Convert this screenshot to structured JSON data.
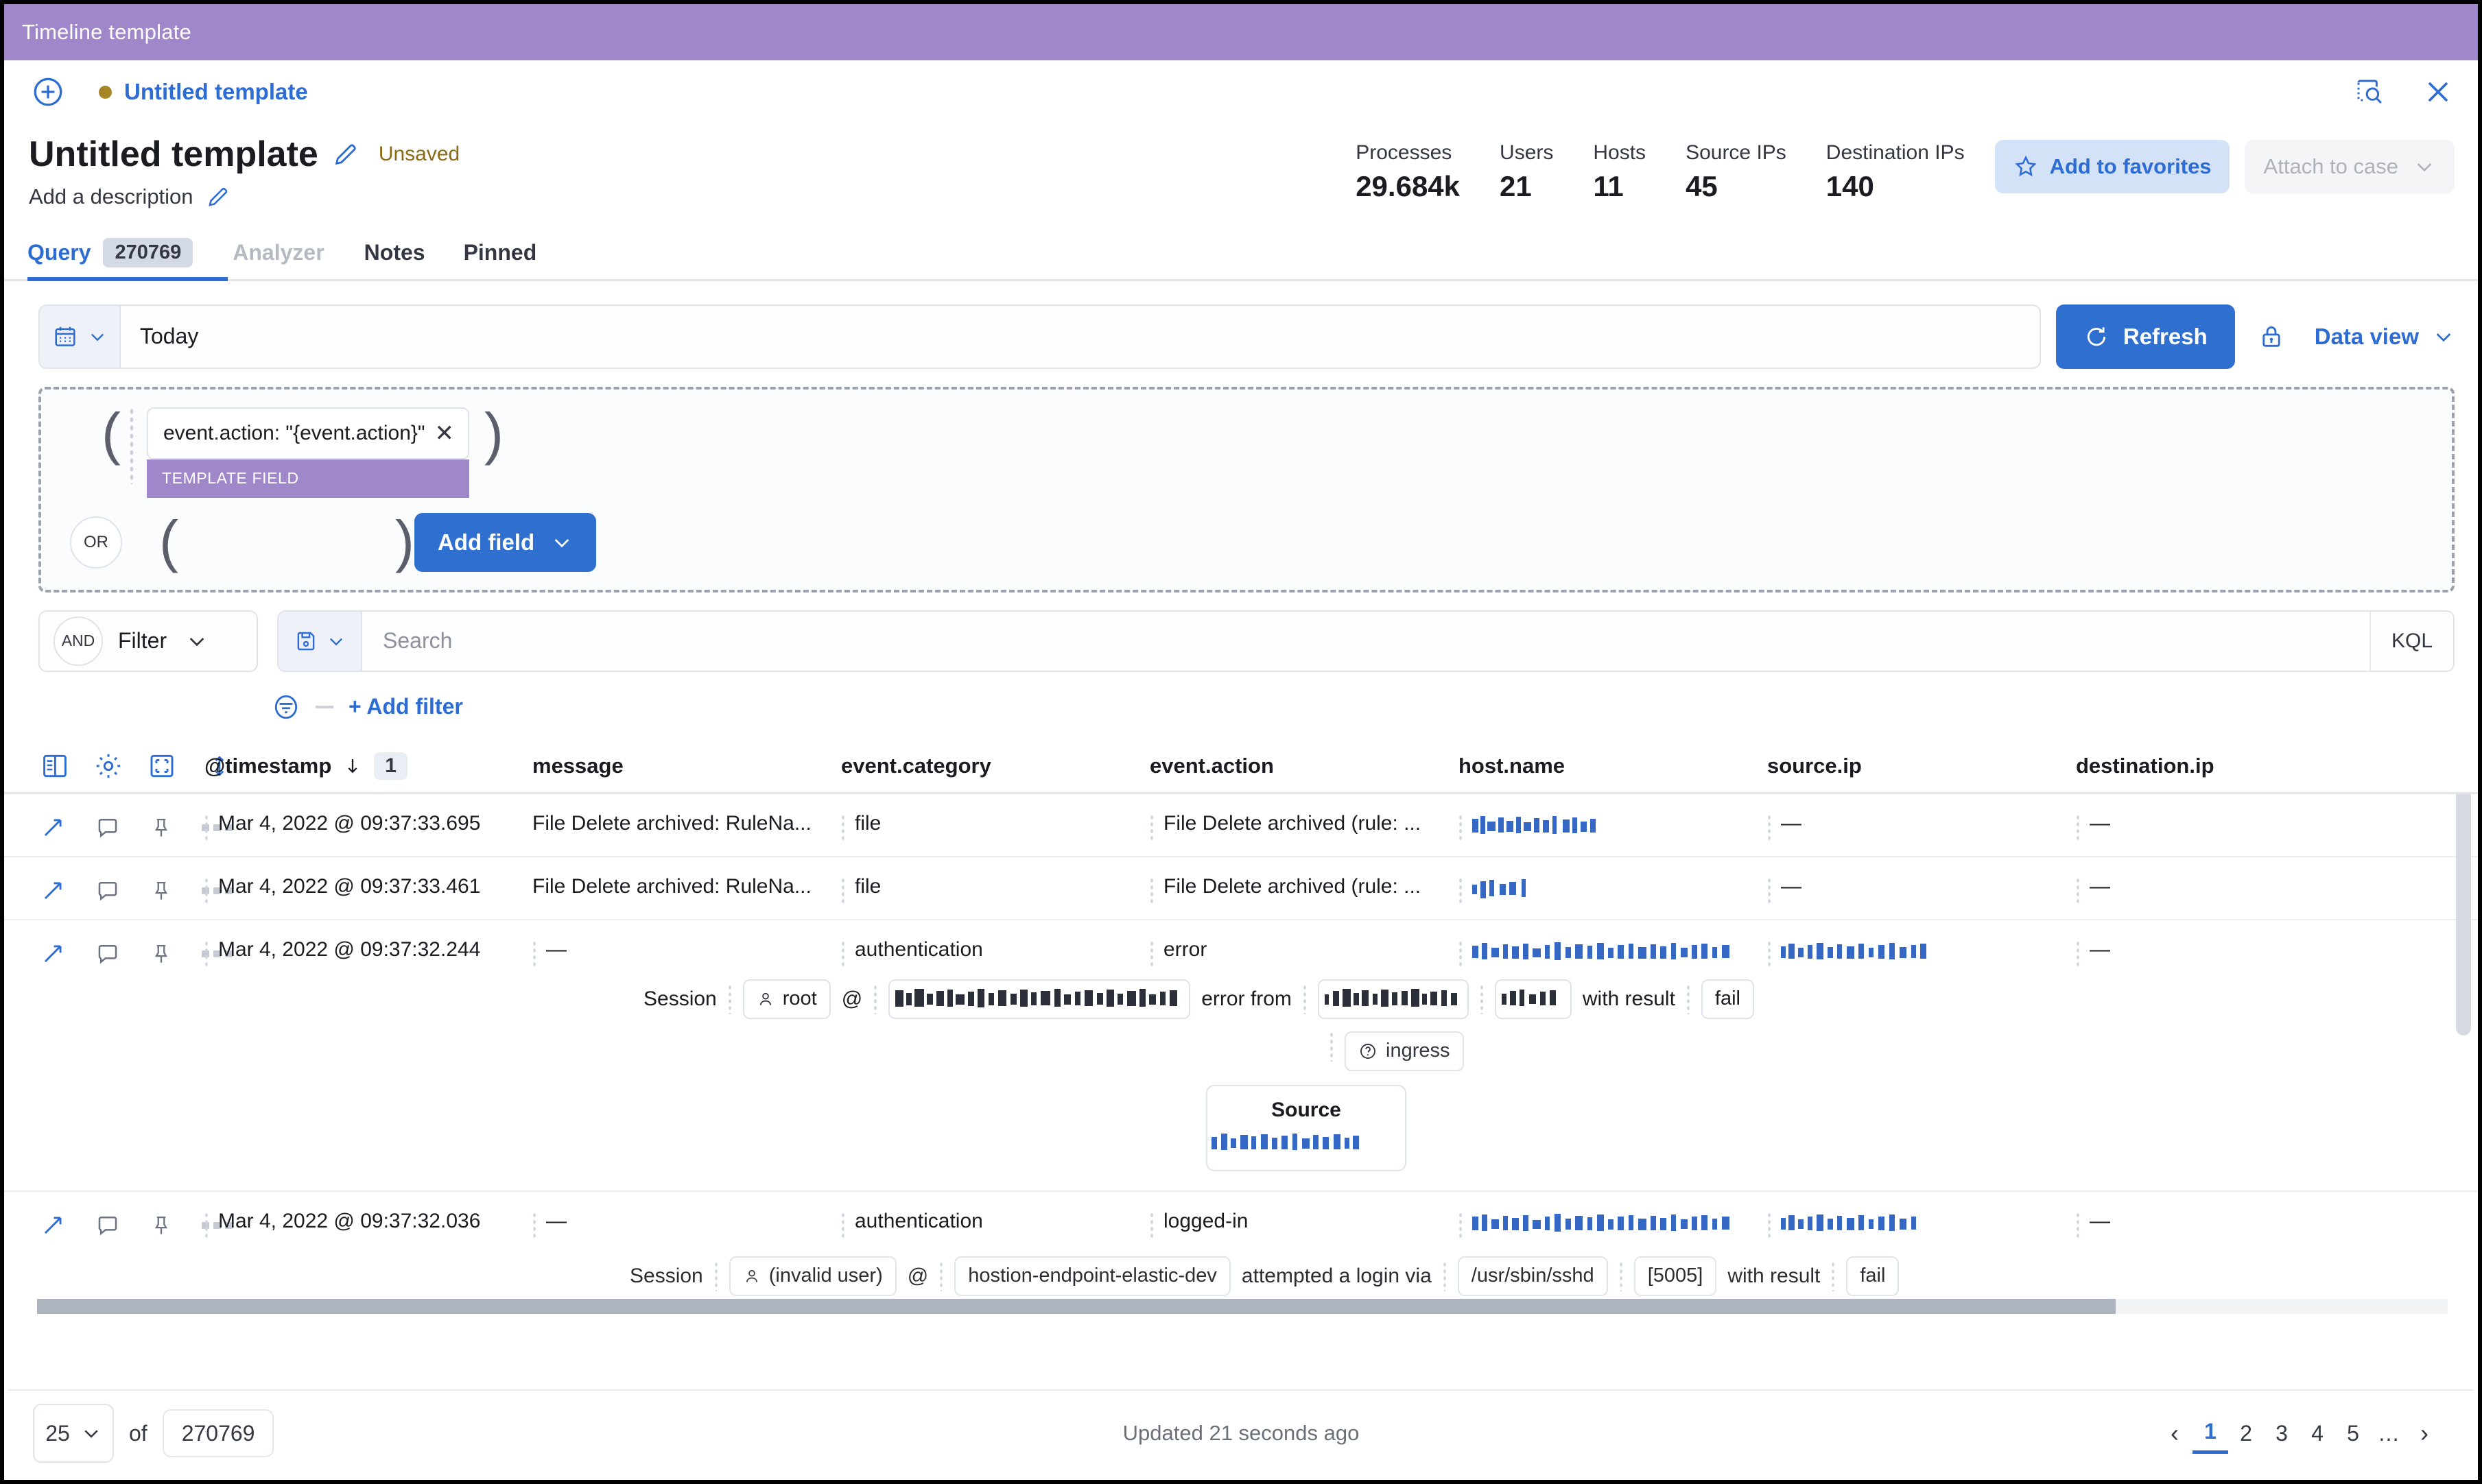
{
  "window": {
    "title": "Timeline template"
  },
  "tabstrip": {
    "add_label": "add-timeline",
    "tab_label": "Untitled template",
    "inspect_label": "inspect",
    "close_label": "close"
  },
  "header": {
    "title": "Untitled template",
    "status": "Unsaved",
    "description_placeholder": "Add a description",
    "stats": [
      {
        "label": "Processes",
        "value": "29.684k"
      },
      {
        "label": "Users",
        "value": "21"
      },
      {
        "label": "Hosts",
        "value": "11"
      },
      {
        "label": "Source IPs",
        "value": "45"
      },
      {
        "label": "Destination IPs",
        "value": "140"
      }
    ],
    "favorites_label": "Add to favorites",
    "attach_case_label": "Attach to case"
  },
  "nav_tabs": [
    {
      "label": "Query",
      "count": "270769",
      "active": true
    },
    {
      "label": "Analyzer",
      "count": "",
      "active": false,
      "disabled": true
    },
    {
      "label": "Notes",
      "count": "",
      "active": false
    },
    {
      "label": "Pinned",
      "count": "",
      "active": false
    }
  ],
  "query_bar": {
    "date_value": "Today",
    "refresh_label": "Refresh",
    "data_view_label": "Data view"
  },
  "builder": {
    "field_chip": "event.action: \"{event.action}\"",
    "template_badge": "TEMPLATE FIELD",
    "or_label": "OR",
    "add_field_label": "Add field",
    "open_paren": "(",
    "close_paren": ")"
  },
  "filter_bar": {
    "and_label": "AND",
    "filter_label": "Filter",
    "search_placeholder": "Search",
    "kql_label": "KQL",
    "add_filter_label": "+ Add filter"
  },
  "table": {
    "columns": [
      "@timestamp",
      "message",
      "event.category",
      "event.action",
      "host.name",
      "source.ip",
      "destination.ip"
    ],
    "sort_column": "@timestamp",
    "sort_direction": "desc",
    "sort_badge": "1",
    "rows": [
      {
        "timestamp": "Mar 4, 2022 @ 09:37:33.695",
        "message": "File Delete archived: RuleNa...",
        "event_category": "file",
        "event_action": "File Delete archived (rule: ...",
        "host_name": "",
        "host_redacted": true,
        "source_ip": "—",
        "destination_ip": "—",
        "expanded": false
      },
      {
        "timestamp": "Mar 4, 2022 @ 09:37:33.461",
        "message": "File Delete archived: RuleNa...",
        "event_category": "file",
        "event_action": "File Delete archived (rule: ...",
        "host_name": "",
        "host_redacted": true,
        "source_ip": "—",
        "destination_ip": "—",
        "expanded": false
      },
      {
        "timestamp": "Mar 4, 2022 @ 09:37:32.244",
        "message": "—",
        "event_category": "authentication",
        "event_action": "error",
        "host_name": "",
        "host_redacted": true,
        "source_ip": "",
        "source_redacted": true,
        "destination_ip": "—",
        "expanded": true,
        "detail": {
          "session_label": "Session",
          "user_chip": "root",
          "at_symbol": "@",
          "host_chip_redacted": true,
          "error_label": "error from",
          "from_chip_redacted": true,
          "port_chip_redacted": true,
          "with_result_label": "with result",
          "result_chip": "fail",
          "ingress_chip": "ingress",
          "source_box_title": "Source",
          "source_box_redacted": true
        }
      },
      {
        "timestamp": "Mar 4, 2022 @ 09:37:32.036",
        "message": "—",
        "event_category": "authentication",
        "event_action": "logged-in",
        "host_name": "",
        "host_redacted": true,
        "source_ip": "",
        "source_redacted": true,
        "destination_ip": "—",
        "expanded": false
      }
    ],
    "clipped_row": {
      "session_label": "Session",
      "user_chip": "(invalid user)",
      "at_symbol": "@",
      "host_chip": "hostion-endpoint-elastic-dev",
      "attempt_label": "attempted a login via",
      "path_chip": "/usr/sbin/sshd",
      "port_chip": "[5005]",
      "with_result_label": "with result",
      "result_chip": "fail"
    }
  },
  "footer": {
    "per_page": "25",
    "of_label": "of",
    "total": "270769",
    "updated_text": "Updated 21 seconds ago",
    "pages": [
      "1",
      "2",
      "3",
      "4",
      "5",
      "…"
    ],
    "active_page": "1",
    "prev_label": "‹",
    "next_label": "›"
  },
  "colors": {
    "titlebar": "#a087c9",
    "accent": "#2d6cd3",
    "primary_button": "#2f6fd0",
    "template_badge": "#a087c9",
    "unsaved": "#8a6a12",
    "dot": "#a68526"
  }
}
